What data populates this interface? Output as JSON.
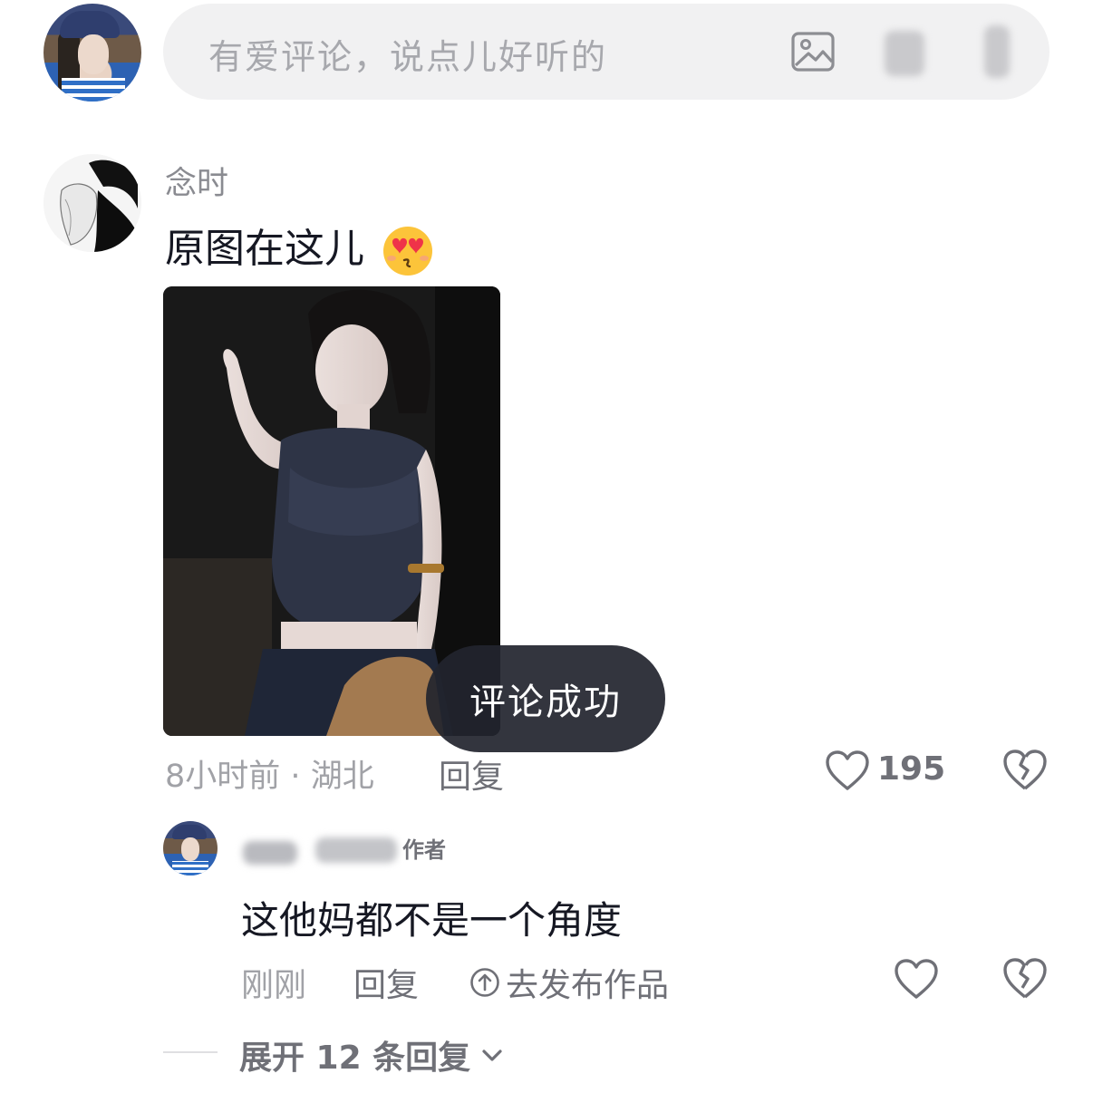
{
  "composer": {
    "placeholder": "有爱评论，说点儿好听的",
    "image_icon": "image-icon"
  },
  "comment": {
    "username": "念时",
    "text": "原图在这儿",
    "emoji": "heart-eyes-kiss-emoji",
    "time": "8小时前",
    "location": "湖北",
    "separator": "·",
    "reply_label": "回复",
    "like_count": "195"
  },
  "toast": {
    "text": "评论成功"
  },
  "reply": {
    "author_tag": "作者",
    "text": "这他妈都不是一个角度",
    "time": "刚刚",
    "reply_label": "回复",
    "publish_label": "去发布作品"
  },
  "expand": {
    "label": "展开 12 条回复"
  }
}
